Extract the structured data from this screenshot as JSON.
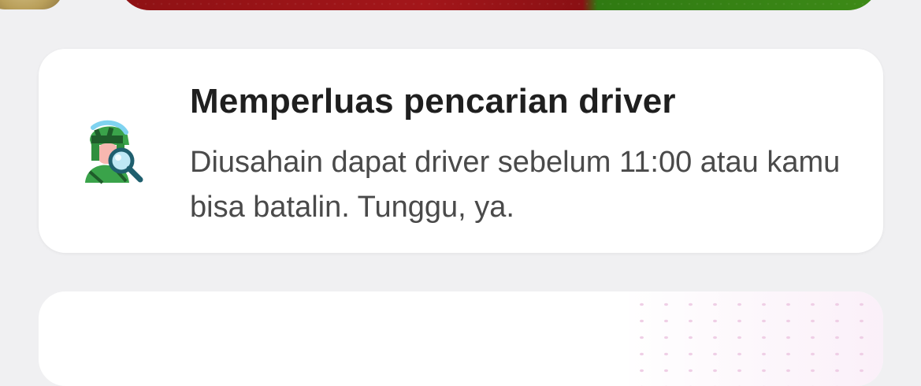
{
  "status_card": {
    "icon": "driver-search-icon",
    "title": "Memperluas pencarian driver",
    "description": "Diusahain dapat driver sebelum 11:00 atau kamu bisa batalin. Tunggu, ya."
  },
  "colors": {
    "background": "#f0f0f2",
    "card": "#ffffff",
    "title_text": "#1f1f1f",
    "body_text": "#4a4a4a",
    "banner_red": "#8e1114",
    "banner_green": "#3d8a17"
  }
}
